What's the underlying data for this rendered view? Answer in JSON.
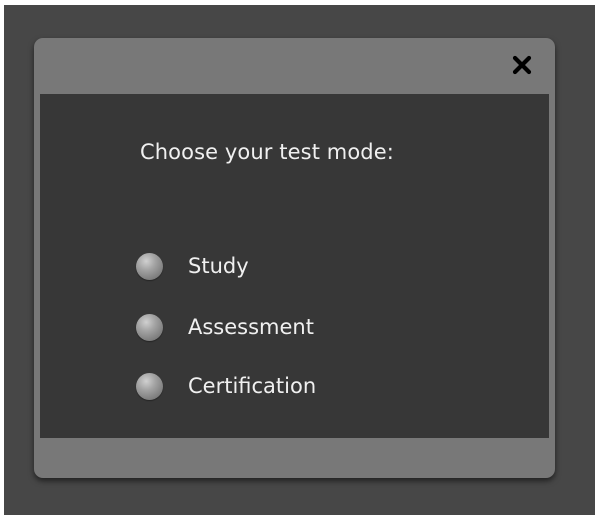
{
  "dialog": {
    "close_icon": "close-icon",
    "prompt": "Choose your test mode:",
    "options": [
      {
        "label": "Study",
        "selected": false
      },
      {
        "label": "Assessment",
        "selected": false
      },
      {
        "label": "Certification",
        "selected": false
      }
    ]
  },
  "colors": {
    "backdrop": "#474747",
    "dialog_frame": "#787878",
    "dialog_body": "#373737",
    "text": "#f0f0f0"
  }
}
